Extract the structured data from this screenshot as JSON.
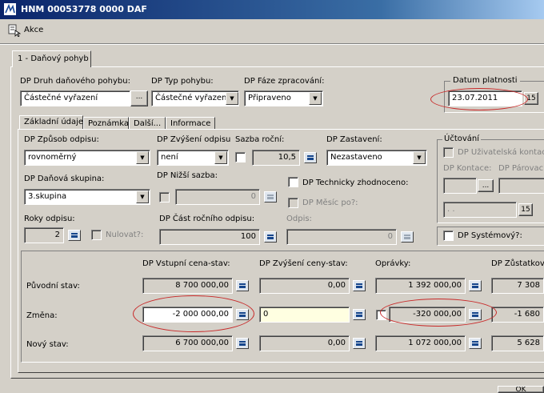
{
  "window": {
    "title": "HNM 00053778 0000 DAF"
  },
  "menu": {
    "akce": "Akce"
  },
  "tabs_main": [
    "1 - Daňový pohyb"
  ],
  "header": {
    "druh_label": "DP Druh daňového pohybu:",
    "druh_value": "Částečné vyřazení",
    "typ_label": "DP Typ pohybu:",
    "typ_value": "Částečné vyřazení",
    "faze_label": "DP Fáze zpracování:",
    "faze_value": "Připraveno",
    "datum_group": "Datum platnosti",
    "datum_value": "23.07.2011",
    "datum_btn": "15"
  },
  "subtabs": [
    "Základní údaje",
    "Poznámka",
    "Další...",
    "Informace"
  ],
  "basic": {
    "zpusob_label": "DP Způsob odpisu:",
    "zpusob_value": "rovnoměrný",
    "zvyseni_label": "DP Zvýšení odpisu",
    "zvyseni_value": "není",
    "sazba_label": "Sazba roční:",
    "sazba_value": "10,5",
    "zastaveni_label": "DP Zastavení:",
    "zastaveni_value": "Nezastaveno",
    "skupina_label": "DP Daňová skupina:",
    "skupina_value": "3.skupina",
    "nizsi_label": "DP Nižší sazba:",
    "nizsi_value": "0",
    "technicky_label": "DP Technicky zhodnoceno:",
    "mesic_label": "DP Měsíc po?:",
    "roky_label": "Roky odpisu:",
    "roky_value": "2",
    "nulovat_label": "Nulovat?:",
    "cast_label": "DP Část ročního odpisu:",
    "cast_value": "100",
    "odpis_label": "Odpis:",
    "odpis_value": "0"
  },
  "uctovani": {
    "group": "Účtování",
    "kontace_chk": "DP Uživatelská kontace",
    "kontace_label": "DP Kontace:",
    "parovaci_label": "DP Párovací",
    "btn_dots": "...",
    "date_value": ". .",
    "date_btn": "15",
    "systemovy_label": "DP Systémový?:"
  },
  "grid": {
    "headers": [
      "DP Vstupní cena-stav:",
      "DP Zvýšení ceny-stav:",
      "Oprávky:",
      "DP Zůstatková"
    ],
    "rows": [
      {
        "label": "Původní stav:",
        "values": [
          "8 700 000,00",
          "0,00",
          "1 392 000,00",
          "7 308"
        ]
      },
      {
        "label": "Změna:",
        "values": [
          "-2 000 000,00",
          "0",
          "-320 000,00",
          "-1 680"
        ]
      },
      {
        "label": "Nový stav:",
        "values": [
          "6 700 000,00",
          "0,00",
          "1 072 000,00",
          "5 628"
        ]
      }
    ]
  },
  "footer": {
    "ok": "OK"
  }
}
